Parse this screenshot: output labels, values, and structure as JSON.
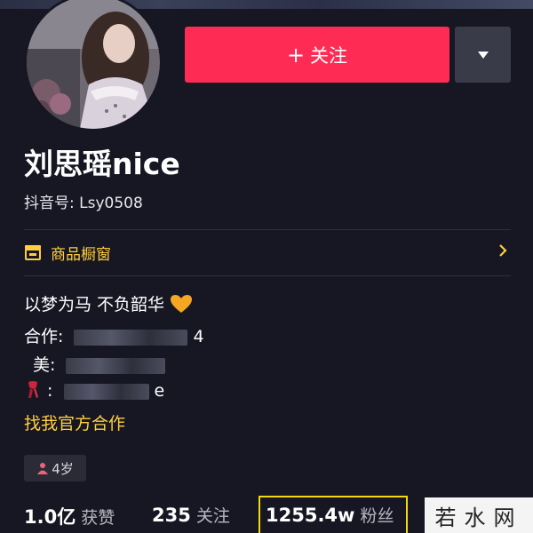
{
  "profile": {
    "name": "刘思瑶nice",
    "douyin_id": "抖音号: Lsy0508"
  },
  "actions": {
    "follow_plus": "+",
    "follow_label": "关注"
  },
  "showcase": {
    "label": "商品橱窗"
  },
  "bio": {
    "line1": "以梦为马 不负韶华",
    "line2_prefix": "合作:",
    "line2_suffix": "4",
    "line3_prefix": "美:",
    "line4_prefix": ":",
    "line4_suffix": "e",
    "official_link": "找我官方合作"
  },
  "tags": {
    "age": "4岁"
  },
  "stats": {
    "likes_num": "1.0亿",
    "likes_label": "获赞",
    "following_num": "235",
    "following_label": "关注",
    "followers_num": "1255.4w",
    "followers_label": "粉丝"
  },
  "watermark": {
    "text": "若水网"
  },
  "colors": {
    "background": "#161723",
    "follow_button": "#fe2c55",
    "accent_yellow": "#ffce3d",
    "highlight_box": "#f5d90a"
  }
}
